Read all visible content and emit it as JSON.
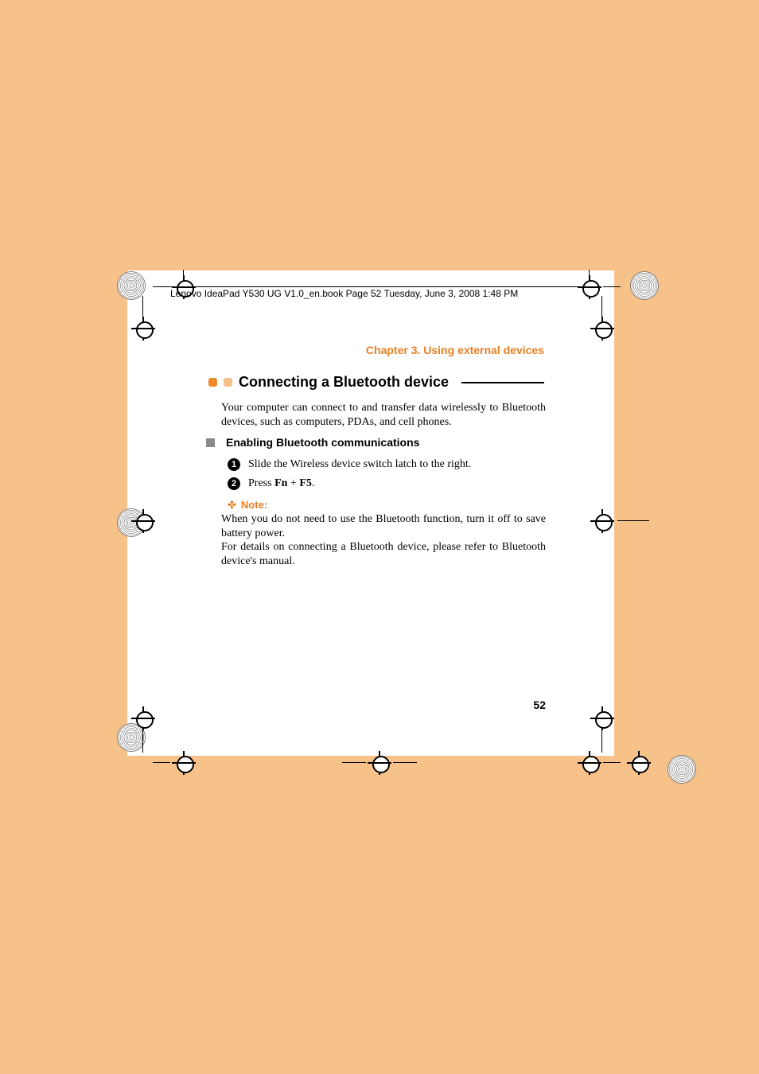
{
  "header_line": "Lenovo IdeaPad Y530 UG V1.0_en.book  Page 52  Tuesday, June 3, 2008  1:48 PM",
  "chapter": "Chapter 3. Using external devices",
  "section_title": "Connecting a Bluetooth device",
  "intro_para": "Your computer can connect to and transfer data wirelessly to Bluetooth devices, such as computers, PDAs, and cell phones.",
  "sub_title": "Enabling Bluetooth communications",
  "steps": {
    "s1": "Slide the Wireless device switch latch to the right.",
    "s2_pre": "Press ",
    "s2_fn": "Fn",
    "s2_plus": " + ",
    "s2_f5": "F5",
    "s2_post": "."
  },
  "note_label": "Note:",
  "note_body_1": "When you do not need to use the Bluetooth function, turn it off to save battery power.",
  "note_body_2": "For details on connecting a Bluetooth device, please refer to Bluetooth device's manual.",
  "page_number": "52"
}
